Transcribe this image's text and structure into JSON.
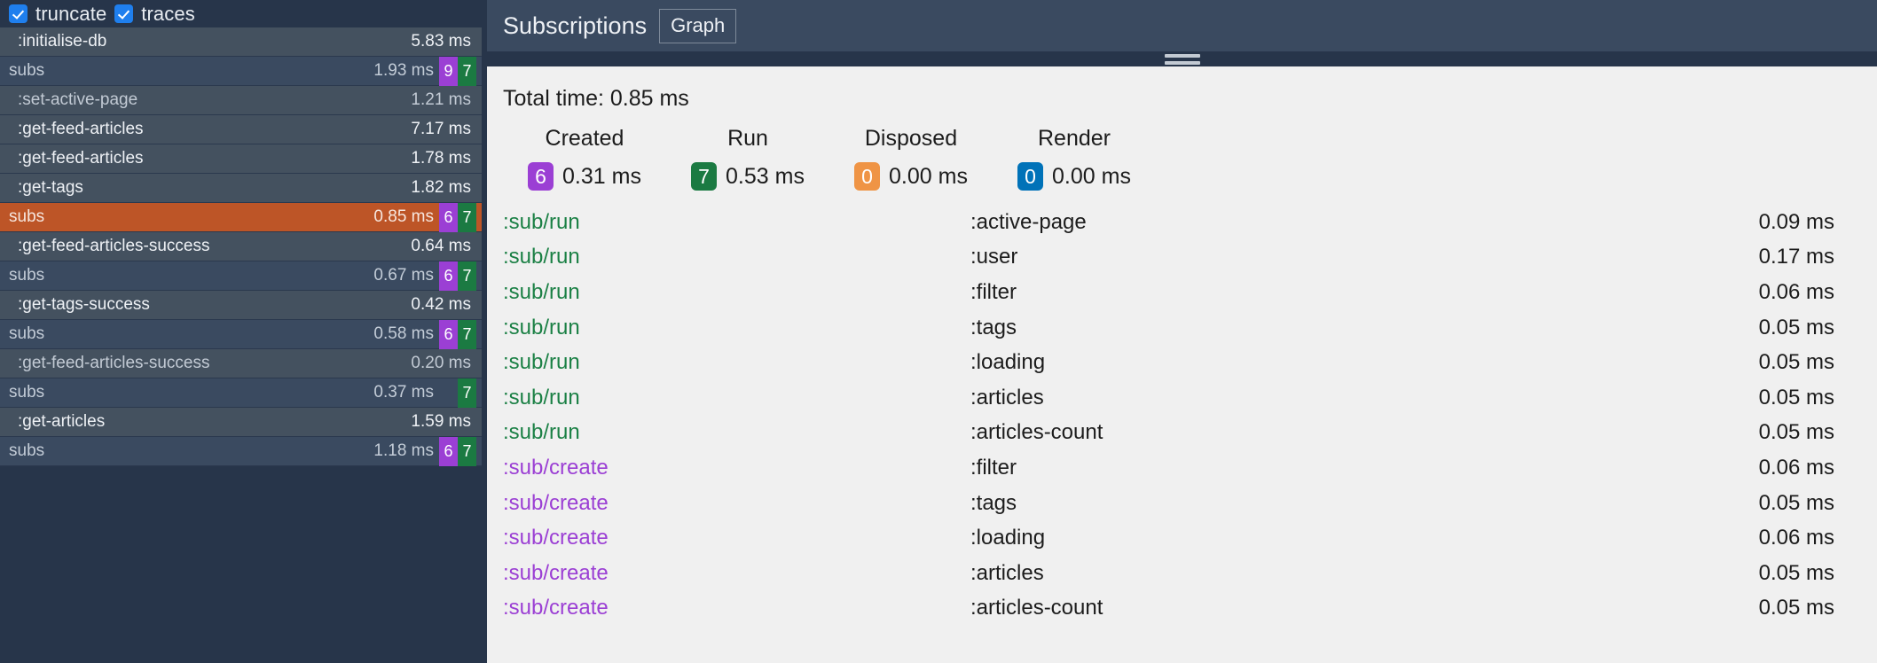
{
  "sidebar": {
    "toolbar": {
      "checkboxes": [
        {
          "label": "truncate",
          "checked": true,
          "icon": "checkbox-checked-icon"
        },
        {
          "label": "traces",
          "checked": true,
          "icon": "checkbox-checked-icon"
        }
      ]
    },
    "rows": [
      {
        "kind": "event",
        "name": ":initialise-db",
        "time": "5.83 ms",
        "badges": [],
        "selected": false
      },
      {
        "kind": "subs",
        "name": "subs",
        "time": "1.93 ms",
        "badges": [
          {
            "v": "9",
            "c": "purple"
          },
          {
            "v": "7",
            "c": "green"
          }
        ],
        "selected": false
      },
      {
        "kind": "event",
        "name": ":set-active-page",
        "time": "1.21 ms",
        "badges": [],
        "selected": false,
        "dim": true
      },
      {
        "kind": "event",
        "name": ":get-feed-articles",
        "time": "7.17 ms",
        "badges": [],
        "selected": false
      },
      {
        "kind": "event",
        "name": ":get-feed-articles",
        "time": "1.78 ms",
        "badges": [],
        "selected": false
      },
      {
        "kind": "event",
        "name": ":get-tags",
        "time": "1.82 ms",
        "badges": [],
        "selected": false
      },
      {
        "kind": "subs",
        "name": "subs",
        "time": "0.85 ms",
        "badges": [
          {
            "v": "6",
            "c": "purple"
          },
          {
            "v": "7",
            "c": "green"
          }
        ],
        "selected": true
      },
      {
        "kind": "event",
        "name": ":get-feed-articles-success",
        "time": "0.64 ms",
        "badges": [],
        "selected": false
      },
      {
        "kind": "subs",
        "name": "subs",
        "time": "0.67 ms",
        "badges": [
          {
            "v": "6",
            "c": "purple"
          },
          {
            "v": "7",
            "c": "green"
          }
        ],
        "selected": false
      },
      {
        "kind": "event",
        "name": ":get-tags-success",
        "time": "0.42 ms",
        "badges": [],
        "selected": false
      },
      {
        "kind": "subs",
        "name": "subs",
        "time": "0.58 ms",
        "badges": [
          {
            "v": "6",
            "c": "purple"
          },
          {
            "v": "7",
            "c": "green"
          }
        ],
        "selected": false
      },
      {
        "kind": "event",
        "name": ":get-feed-articles-success",
        "time": "0.20 ms",
        "badges": [],
        "selected": false,
        "dim": true
      },
      {
        "kind": "subs",
        "name": "subs",
        "time": "0.37 ms",
        "badges": [
          {
            "v": "7",
            "c": "green"
          }
        ],
        "selected": false
      },
      {
        "kind": "event",
        "name": ":get-articles",
        "time": "1.59 ms",
        "badges": [],
        "selected": false
      },
      {
        "kind": "subs",
        "name": "subs",
        "time": "1.18 ms",
        "badges": [
          {
            "v": "6",
            "c": "purple"
          },
          {
            "v": "7",
            "c": "green"
          }
        ],
        "selected": false
      }
    ]
  },
  "panel": {
    "title": "Subscriptions",
    "tab_label": "Graph",
    "drag_handle_icon": "drag-handle-icon",
    "total_time_label": "Total time: 0.85 ms",
    "stats": [
      {
        "label": "Created",
        "count": "6",
        "time": "0.31 ms",
        "color": "#9b3fd4"
      },
      {
        "label": "Run",
        "count": "7",
        "time": "0.53 ms",
        "color": "#1b7a42"
      },
      {
        "label": "Disposed",
        "count": "0",
        "time": "0.00 ms",
        "color": "#ef9445"
      },
      {
        "label": "Render",
        "count": "0",
        "time": "0.00 ms",
        "color": "#0072b8"
      }
    ],
    "subscription_rows": [
      {
        "op": ":sub/run",
        "type": "run",
        "key": ":active-page",
        "time": "0.09 ms"
      },
      {
        "op": ":sub/run",
        "type": "run",
        "key": ":user",
        "time": "0.17 ms"
      },
      {
        "op": ":sub/run",
        "type": "run",
        "key": ":filter",
        "time": "0.06 ms"
      },
      {
        "op": ":sub/run",
        "type": "run",
        "key": ":tags",
        "time": "0.05 ms"
      },
      {
        "op": ":sub/run",
        "type": "run",
        "key": ":loading",
        "time": "0.05 ms"
      },
      {
        "op": ":sub/run",
        "type": "run",
        "key": ":articles",
        "time": "0.05 ms"
      },
      {
        "op": ":sub/run",
        "type": "run",
        "key": ":articles-count",
        "time": "0.05 ms"
      },
      {
        "op": ":sub/create",
        "type": "create",
        "key": ":filter",
        "time": "0.06 ms"
      },
      {
        "op": ":sub/create",
        "type": "create",
        "key": ":tags",
        "time": "0.05 ms"
      },
      {
        "op": ":sub/create",
        "type": "create",
        "key": ":loading",
        "time": "0.06 ms"
      },
      {
        "op": ":sub/create",
        "type": "create",
        "key": ":articles",
        "time": "0.05 ms"
      },
      {
        "op": ":sub/create",
        "type": "create",
        "key": ":articles-count",
        "time": "0.05 ms"
      }
    ]
  },
  "colors": {
    "app_bg": "#27354a",
    "sidebar_row_subs": "#3a4a60",
    "sidebar_row_event": "#44515f",
    "selected_row": "#bd5527",
    "panel_bg": "#f0f0f0",
    "accent_purple": "#9b3fd4",
    "accent_green": "#1b7a42",
    "accent_orange": "#ef9445",
    "accent_blue": "#0072b8",
    "checkbox_blue": "#1f7fee"
  }
}
